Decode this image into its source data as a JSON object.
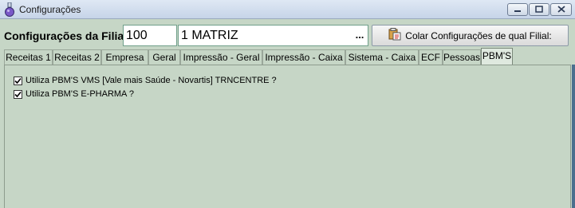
{
  "window": {
    "title": "Configurações",
    "icon": "flask-icon"
  },
  "filial": {
    "label": "Configurações da Filial:",
    "code": "100",
    "name": "1 MATRIZ",
    "lookup_label": "...",
    "paste_button_label": "Colar Configurações de qual Filial:",
    "paste_icon": "paste-icon"
  },
  "tabs": [
    {
      "label": "Receitas 1",
      "active": false
    },
    {
      "label": "Receitas 2",
      "active": false
    },
    {
      "label": "Empresa",
      "active": false
    },
    {
      "label": "Geral",
      "active": false
    },
    {
      "label": "Impressão - Geral",
      "active": false
    },
    {
      "label": "Impressão - Caixa",
      "active": false
    },
    {
      "label": "Sistema - Caixa",
      "active": false
    },
    {
      "label": "ECF",
      "active": false
    },
    {
      "label": "Pessoas",
      "active": false
    },
    {
      "label": "PBM'S",
      "active": true
    }
  ],
  "pbm_options": [
    {
      "label": "Utiliza PBM'S VMS [Vale mais Saúde - Novartis] TRNCENTRE ?",
      "checked": true
    },
    {
      "label": "Utiliza PBM'S E-PHARMA ?",
      "checked": true
    }
  ],
  "colors": {
    "background": "#c6d6c6",
    "field_border": "#6f9f8a",
    "titlebar": "#c6d4e8"
  }
}
